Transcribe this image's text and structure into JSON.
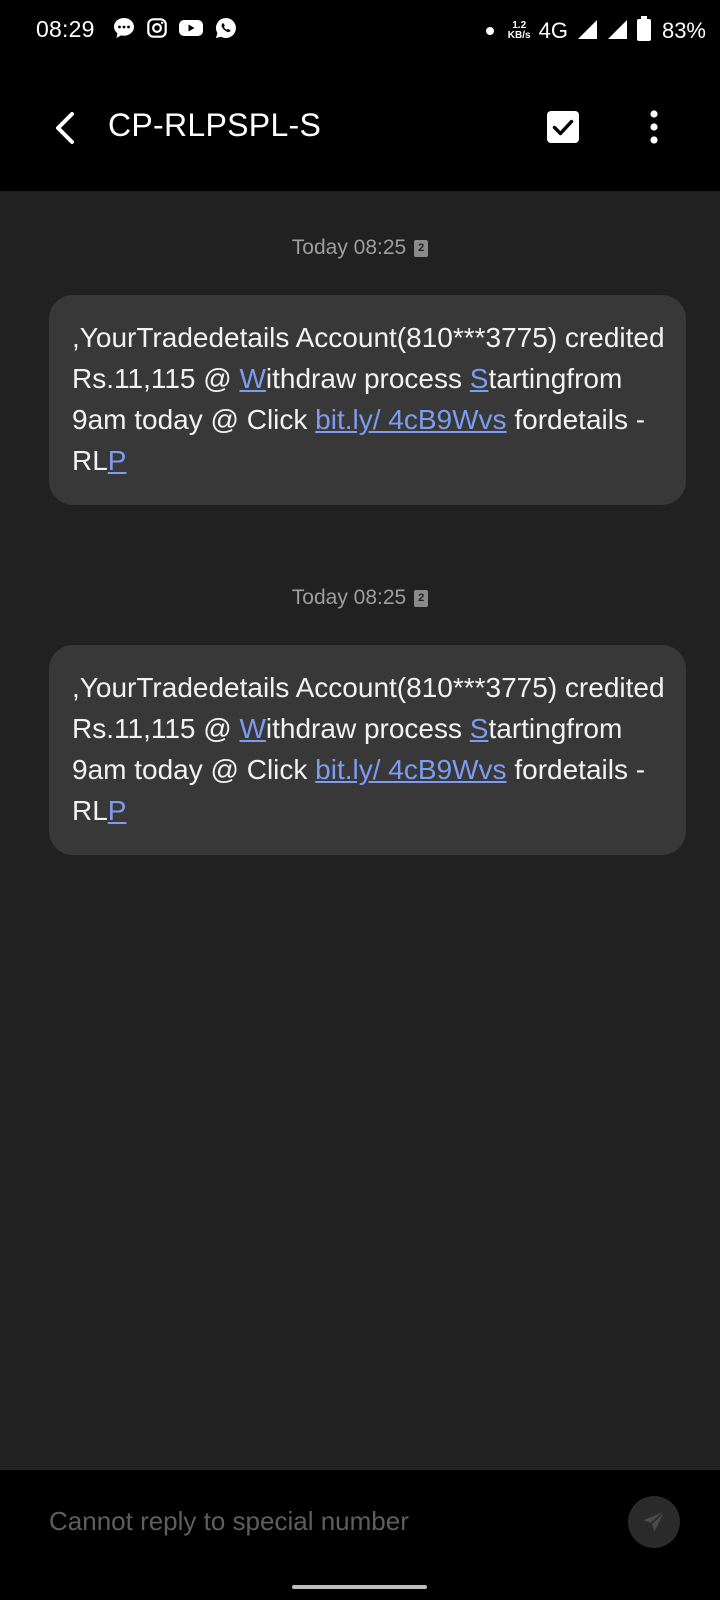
{
  "status_bar": {
    "time": "08:29",
    "notification_icons": [
      "chat-bubble-icon",
      "instagram-icon",
      "youtube-icon",
      "whatsapp-icon"
    ],
    "net_speed_value": "1.2",
    "net_speed_unit": "KB/s",
    "network_type": "4G",
    "battery_percent": "83%"
  },
  "app_bar": {
    "title": "CP-RLPSPL-S"
  },
  "messages": [
    {
      "timestamp": "Today 08:25",
      "sim": "2",
      "text_parts": [
        ",YourTradedetails Account(810***3775) credited Rs.11,115 @ ",
        "W",
        "ithdraw process ",
        "S",
        "tartingfrom 9am today @ Click ",
        "bit.ly/ 4cB9Wvs",
        " fordetails - RL",
        "P"
      ]
    },
    {
      "timestamp": "Today 08:25",
      "sim": "2",
      "text_parts": [
        ",YourTradedetails Account(810***3775) credited Rs.11,115 @ ",
        "W",
        "ithdraw process ",
        "S",
        "tartingfrom 9am today @ Click ",
        "bit.ly/ 4cB9Wvs",
        " fordetails - RL",
        "P"
      ]
    }
  ],
  "input": {
    "placeholder": "Cannot reply to special number"
  },
  "colors": {
    "background": "#212121",
    "bars": "#000000",
    "bubble": "#383838",
    "link": "#7d9cf0",
    "muted_text": "#9e9e9e"
  }
}
